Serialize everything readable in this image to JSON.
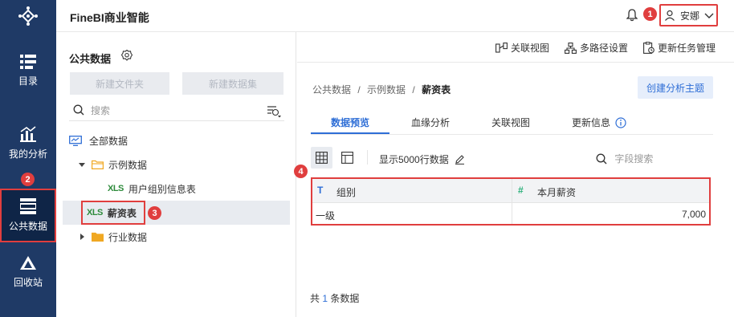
{
  "app": {
    "title": "FineBI商业智能"
  },
  "user": {
    "name": "安娜"
  },
  "nav": {
    "items": [
      {
        "label": "目录",
        "icon": "catalog-icon"
      },
      {
        "label": "我的分析",
        "icon": "chart-icon"
      },
      {
        "label": "公共数据",
        "icon": "database-icon"
      },
      {
        "label": "回收站",
        "icon": "recycle-icon"
      }
    ],
    "active": "公共数据"
  },
  "panel": {
    "title": "公共数据",
    "new_folder": "新建文件夹",
    "new_dataset": "新建数据集",
    "search_placeholder": "搜索",
    "tree": {
      "root": "全部数据",
      "folder1": "示例数据",
      "item1": "用户组别信息表",
      "item2": "薪资表",
      "folder2": "行业数据",
      "xls": "XLS"
    }
  },
  "toolbar": {
    "related_view": "关联视图",
    "multipath": "多路径设置",
    "update_task": "更新任务管理"
  },
  "main": {
    "breadcrumb": {
      "part1": "公共数据",
      "sep": "/",
      "part2": "示例数据",
      "current": "薪资表"
    },
    "create_button": "创建分析主题",
    "tabs": [
      {
        "label": "数据预览"
      },
      {
        "label": "血缘分析"
      },
      {
        "label": "关联视图"
      },
      {
        "label": "更新信息"
      }
    ],
    "active_tab": "数据预览",
    "rows_label": "显示5000行数据",
    "field_search_placeholder": "字段搜索",
    "table": {
      "columns": [
        {
          "type": "T",
          "name": "组别"
        },
        {
          "type": "#",
          "name": "本月薪资"
        }
      ],
      "rows": [
        [
          "一级",
          "7,000"
        ]
      ]
    },
    "footer": {
      "prefix": "共",
      "count": "1",
      "suffix": "条数据"
    }
  },
  "markers": [
    "1",
    "2",
    "3",
    "4"
  ],
  "colors": {
    "nav_bg": "#1f3a66",
    "accent": "#2e6ed6",
    "highlight": "#e03e3e"
  }
}
